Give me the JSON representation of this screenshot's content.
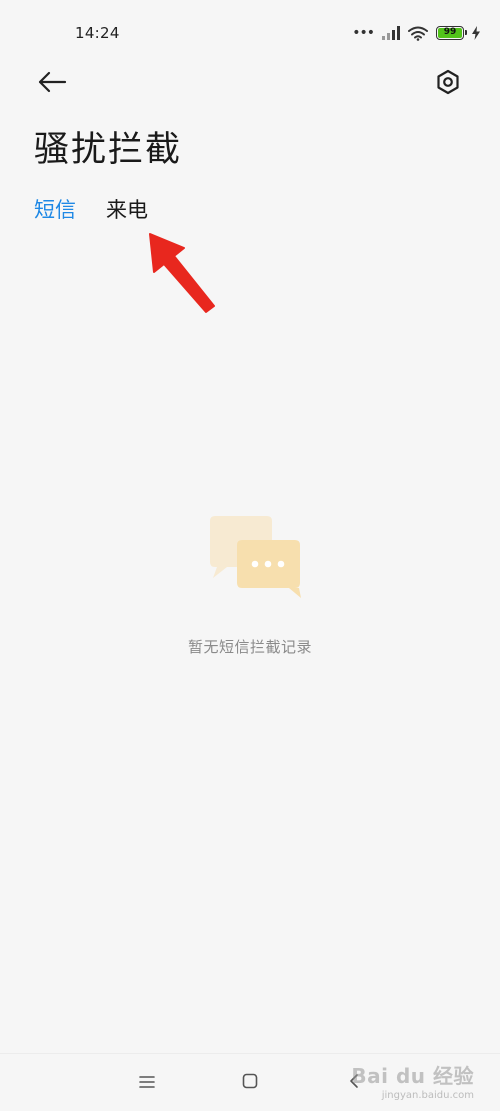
{
  "status_bar": {
    "time": "14:24",
    "battery_level": "99",
    "battery_fraction": 0.99,
    "battery_color": "#52c41a",
    "icons": [
      "more-dots-icon",
      "signal-icon",
      "wifi-icon",
      "battery-icon",
      "charging-bolt-icon"
    ]
  },
  "toolbar": {
    "back_icon": "arrow-left-icon",
    "settings_icon": "hexagon-settings-icon"
  },
  "page": {
    "title": "骚扰拦截"
  },
  "tabs": [
    {
      "label": "短信",
      "active": true
    },
    {
      "label": "来电",
      "active": false
    }
  ],
  "colors": {
    "accent": "#1e88e5",
    "annotation": "#e8271e",
    "illustration_back": "#f7ead2",
    "illustration_front": "#f7dfae"
  },
  "empty_state": {
    "icon": "chat-bubbles-icon",
    "message": "暂无短信拦截记录"
  },
  "nav_bar": {
    "icons": [
      "menu-icon",
      "home-square-icon",
      "back-chevron-icon"
    ]
  },
  "watermark": {
    "brand": "Bai du 经验",
    "sub": "jingyan.baidu.com"
  }
}
